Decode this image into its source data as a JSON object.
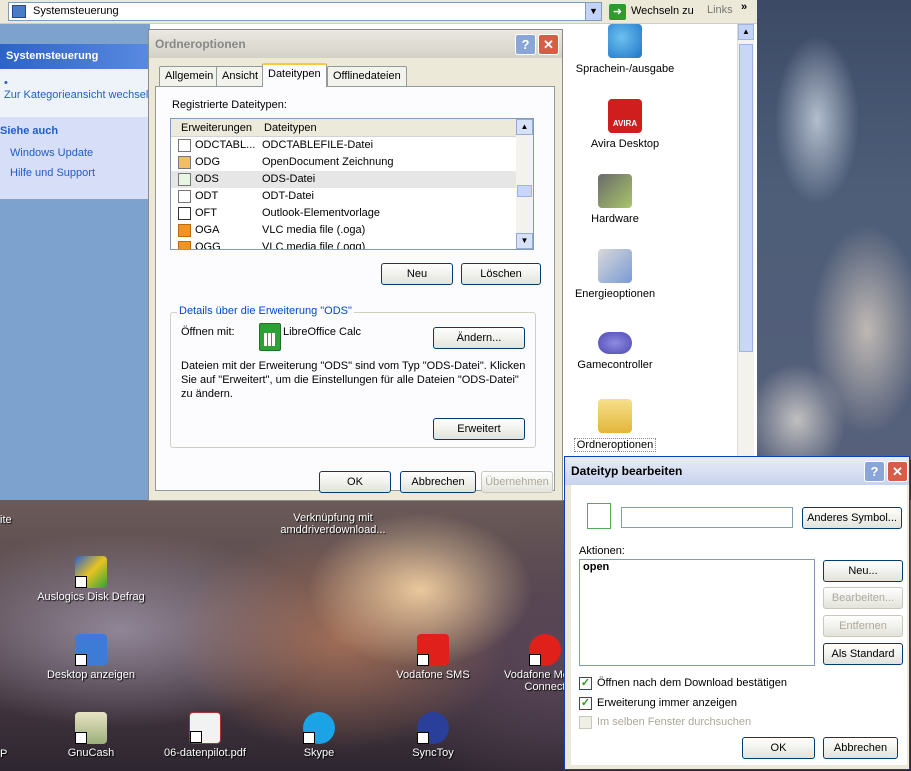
{
  "explorer": {
    "address": "Systemsteuerung",
    "go_label": "Wechseln zu",
    "links_label": "Links",
    "chevron": "»",
    "taskpane": {
      "title": "Systemsteuerung",
      "switch_view": "Zur Kategorieansicht wechseln",
      "see_also": "Siehe auch",
      "windows_update": "Windows Update",
      "help_support": "Hilfe und Support"
    },
    "items": [
      "Sprachein-/ausgabe",
      "Avira Desktop",
      "Hardware",
      "Energieoptionen",
      "Gamecontroller",
      "Ordneroptionen"
    ],
    "avira_logo_text": "AVIRA"
  },
  "desktop": {
    "icons": [
      {
        "label": "Verknüpfung mit amddriverdownload..."
      },
      {
        "label": "Auslogics Disk Defrag"
      },
      {
        "label": "Desktop anzeigen"
      },
      {
        "label": "Vodafone SMS"
      },
      {
        "label": "Vodafone Mobile Connect"
      },
      {
        "label": "GnuCash"
      },
      {
        "label": "06-datenpilot.pdf"
      },
      {
        "label": "Skype"
      },
      {
        "label": "SyncToy"
      }
    ],
    "cut_left_top": "ite",
    "cut_left_bottom": "P"
  },
  "ordneroptionen": {
    "title": "Ordneroptionen",
    "tabs": [
      "Allgemein",
      "Ansicht",
      "Dateitypen",
      "Offlinedateien"
    ],
    "registered_label": "Registrierte Dateitypen:",
    "columns": [
      "Erweiterungen",
      "Dateitypen"
    ],
    "rows": [
      {
        "ext": "ODCTABL...",
        "type": "ODCTABLEFILE-Datei"
      },
      {
        "ext": "ODG",
        "type": "OpenDocument Zeichnung"
      },
      {
        "ext": "ODS",
        "type": "ODS-Datei"
      },
      {
        "ext": "ODT",
        "type": "ODT-Datei"
      },
      {
        "ext": "OFT",
        "type": "Outlook-Elementvorlage"
      },
      {
        "ext": "OGA",
        "type": "VLC media file (.oga)"
      },
      {
        "ext": "OGG",
        "type": "VLC media file (.ogg)"
      }
    ],
    "btn_new": "Neu",
    "btn_delete": "Löschen",
    "details_legend": "Details über die Erweiterung \"ODS\"",
    "opens_with_label": "Öffnen mit:",
    "opens_with_app": "LibreOffice Calc",
    "btn_change": "Ändern...",
    "description": "Dateien mit der Erweiterung \"ODS\" sind vom Typ \"ODS-Datei\". Klicken Sie auf \"Erweitert\", um die Einstellungen für alle Dateien \"ODS-Datei\" zu ändern.",
    "btn_advanced": "Erweitert",
    "btn_ok": "OK",
    "btn_cancel": "Abbrechen",
    "btn_apply": "Übernehmen"
  },
  "dateityp": {
    "title": "Dateityp bearbeiten",
    "name_value": "",
    "btn_other_symbol": "Anderes Symbol...",
    "actions_label": "Aktionen:",
    "actions": [
      "open"
    ],
    "btn_new": "Neu...",
    "btn_edit": "Bearbeiten...",
    "btn_remove": "Entfernen",
    "btn_default": "Als Standard",
    "cb_confirm": "Öffnen nach dem Download bestätigen",
    "cb_show_ext": "Erweiterung immer anzeigen",
    "cb_same_window": "Im selben Fenster durchsuchen",
    "btn_ok": "OK",
    "btn_cancel": "Abbrechen"
  },
  "colors": {
    "xp_blue": "#0046d5",
    "title_active": "#c7d3ee",
    "close_red": "#d85d48",
    "check_green": "#21a121"
  }
}
